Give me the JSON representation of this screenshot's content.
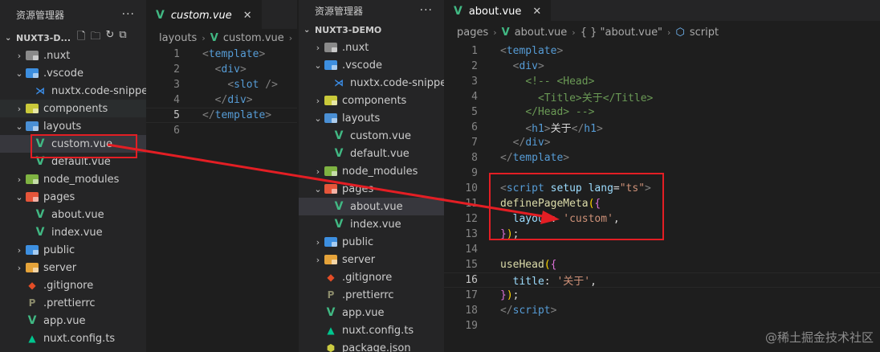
{
  "left": {
    "explorer": {
      "title": "资源管理器",
      "more": "···",
      "root": "NUXT3-D...",
      "items": [
        {
          "label": ".nuxt",
          "kind": "folder",
          "depth": 1,
          "twisty": "›",
          "color": "#8a8a8a"
        },
        {
          "label": ".vscode",
          "kind": "folder",
          "depth": 1,
          "twisty": "⌄",
          "color": "#3d8fe0"
        },
        {
          "label": "nuxtx.code-snippets",
          "kind": "vscode",
          "depth": 2,
          "twisty": ""
        },
        {
          "label": "components",
          "kind": "folder",
          "depth": 1,
          "twisty": "›",
          "color": "#c9c93a",
          "state": "highlight"
        },
        {
          "label": "layouts",
          "kind": "folder",
          "depth": 1,
          "twisty": "⌄",
          "color": "#4a8fd4"
        },
        {
          "label": "custom.vue",
          "kind": "vue",
          "depth": 2,
          "twisty": "",
          "state": "selected"
        },
        {
          "label": "default.vue",
          "kind": "vue",
          "depth": 2,
          "twisty": ""
        },
        {
          "label": "node_modules",
          "kind": "folder",
          "depth": 1,
          "twisty": "›",
          "color": "#7fb342"
        },
        {
          "label": "pages",
          "kind": "folder",
          "depth": 1,
          "twisty": "⌄",
          "color": "#e5553a"
        },
        {
          "label": "about.vue",
          "kind": "vue",
          "depth": 2,
          "twisty": ""
        },
        {
          "label": "index.vue",
          "kind": "vue",
          "depth": 2,
          "twisty": ""
        },
        {
          "label": "public",
          "kind": "folder",
          "depth": 1,
          "twisty": "›",
          "color": "#3d8fe0"
        },
        {
          "label": "server",
          "kind": "folder",
          "depth": 1,
          "twisty": "›",
          "color": "#e5a33a"
        },
        {
          "label": ".gitignore",
          "kind": "git",
          "depth": 1,
          "twisty": ""
        },
        {
          "label": ".prettierrc",
          "kind": "prettier",
          "depth": 1,
          "twisty": ""
        },
        {
          "label": "app.vue",
          "kind": "vue",
          "depth": 1,
          "twisty": ""
        },
        {
          "label": "nuxt.config.ts",
          "kind": "nuxt",
          "depth": 1,
          "twisty": ""
        },
        {
          "label": "",
          "kind": "json",
          "depth": 1,
          "twisty": ""
        }
      ]
    },
    "tab": {
      "label": "custom.vue",
      "close": "✕"
    },
    "breadcrumb": {
      "folder": "layouts",
      "file": "custom.vue"
    },
    "code": {
      "active_line": 5,
      "lines": [
        [
          {
            "c": "t-tag-gray",
            "t": "<"
          },
          {
            "c": "t-tag",
            "t": "template"
          },
          {
            "c": "t-tag-gray",
            "t": ">"
          }
        ],
        [
          {
            "c": "t-plain",
            "t": "  "
          },
          {
            "c": "t-tag-gray",
            "t": "<"
          },
          {
            "c": "t-tag",
            "t": "div"
          },
          {
            "c": "t-tag-gray",
            "t": ">"
          }
        ],
        [
          {
            "c": "t-plain",
            "t": "    "
          },
          {
            "c": "t-tag-gray",
            "t": "<"
          },
          {
            "c": "t-tag",
            "t": "slot"
          },
          {
            "c": "t-tag-gray",
            "t": " />"
          }
        ],
        [
          {
            "c": "t-plain",
            "t": "  "
          },
          {
            "c": "t-tag-gray",
            "t": "</"
          },
          {
            "c": "t-tag",
            "t": "div"
          },
          {
            "c": "t-tag-gray",
            "t": ">"
          }
        ],
        [
          {
            "c": "t-tag-gray",
            "t": "</"
          },
          {
            "c": "t-tag",
            "t": "template"
          },
          {
            "c": "t-tag-gray",
            "t": ">"
          }
        ],
        []
      ]
    }
  },
  "right": {
    "explorer": {
      "title": "资源管理器",
      "more": "···",
      "root": "NUXT3-DEMO",
      "items": [
        {
          "label": ".nuxt",
          "kind": "folder",
          "depth": 1,
          "twisty": "›",
          "color": "#8a8a8a"
        },
        {
          "label": ".vscode",
          "kind": "folder",
          "depth": 1,
          "twisty": "⌄",
          "color": "#3d8fe0"
        },
        {
          "label": "nuxtx.code-snippets",
          "kind": "vscode",
          "depth": 2,
          "twisty": ""
        },
        {
          "label": "components",
          "kind": "folder",
          "depth": 1,
          "twisty": "›",
          "color": "#c9c93a"
        },
        {
          "label": "layouts",
          "kind": "folder",
          "depth": 1,
          "twisty": "⌄",
          "color": "#4a8fd4"
        },
        {
          "label": "custom.vue",
          "kind": "vue",
          "depth": 2,
          "twisty": ""
        },
        {
          "label": "default.vue",
          "kind": "vue",
          "depth": 2,
          "twisty": ""
        },
        {
          "label": "node_modules",
          "kind": "folder",
          "depth": 1,
          "twisty": "›",
          "color": "#7fb342"
        },
        {
          "label": "pages",
          "kind": "folder",
          "depth": 1,
          "twisty": "⌄",
          "color": "#e5553a"
        },
        {
          "label": "about.vue",
          "kind": "vue",
          "depth": 2,
          "twisty": "",
          "state": "selected"
        },
        {
          "label": "index.vue",
          "kind": "vue",
          "depth": 2,
          "twisty": ""
        },
        {
          "label": "public",
          "kind": "folder",
          "depth": 1,
          "twisty": "›",
          "color": "#3d8fe0"
        },
        {
          "label": "server",
          "kind": "folder",
          "depth": 1,
          "twisty": "›",
          "color": "#e5a33a"
        },
        {
          "label": ".gitignore",
          "kind": "git",
          "depth": 1,
          "twisty": ""
        },
        {
          "label": ".prettierrc",
          "kind": "prettier",
          "depth": 1,
          "twisty": ""
        },
        {
          "label": "app.vue",
          "kind": "vue",
          "depth": 1,
          "twisty": ""
        },
        {
          "label": "nuxt.config.ts",
          "kind": "nuxt",
          "depth": 1,
          "twisty": ""
        },
        {
          "label": "package.json",
          "kind": "json",
          "depth": 1,
          "twisty": ""
        }
      ]
    },
    "tab": {
      "label": "about.vue",
      "close": "✕"
    },
    "breadcrumb": {
      "folder": "pages",
      "file": "about.vue",
      "object": "{ } \"about.vue\"",
      "section": "script"
    },
    "code": {
      "active_line": 16,
      "lines": [
        [
          {
            "c": "t-tag-gray",
            "t": "<"
          },
          {
            "c": "t-tag",
            "t": "template"
          },
          {
            "c": "t-tag-gray",
            "t": ">"
          }
        ],
        [
          {
            "c": "t-plain",
            "t": "  "
          },
          {
            "c": "t-tag-gray",
            "t": "<"
          },
          {
            "c": "t-tag",
            "t": "div"
          },
          {
            "c": "t-tag-gray",
            "t": ">"
          }
        ],
        [
          {
            "c": "t-plain",
            "t": "    "
          },
          {
            "c": "t-cmt",
            "t": "<!-- <Head>"
          }
        ],
        [
          {
            "c": "t-plain",
            "t": "      "
          },
          {
            "c": "t-cmt",
            "t": "<Title>关于</Title>"
          }
        ],
        [
          {
            "c": "t-plain",
            "t": "    "
          },
          {
            "c": "t-cmt",
            "t": "</Head> -->"
          }
        ],
        [
          {
            "c": "t-plain",
            "t": "    "
          },
          {
            "c": "t-tag-gray",
            "t": "<"
          },
          {
            "c": "t-tag",
            "t": "h1"
          },
          {
            "c": "t-tag-gray",
            "t": ">"
          },
          {
            "c": "t-plain",
            "t": "关于"
          },
          {
            "c": "t-tag-gray",
            "t": "</"
          },
          {
            "c": "t-tag",
            "t": "h1"
          },
          {
            "c": "t-tag-gray",
            "t": ">"
          }
        ],
        [
          {
            "c": "t-plain",
            "t": "  "
          },
          {
            "c": "t-tag-gray",
            "t": "</"
          },
          {
            "c": "t-tag",
            "t": "div"
          },
          {
            "c": "t-tag-gray",
            "t": ">"
          }
        ],
        [
          {
            "c": "t-tag-gray",
            "t": "</"
          },
          {
            "c": "t-tag",
            "t": "template"
          },
          {
            "c": "t-tag-gray",
            "t": ">"
          }
        ],
        [],
        [
          {
            "c": "t-tag-gray",
            "t": "<"
          },
          {
            "c": "t-tag",
            "t": "script"
          },
          {
            "c": "t-plain",
            "t": " "
          },
          {
            "c": "t-attr",
            "t": "setup"
          },
          {
            "c": "t-plain",
            "t": " "
          },
          {
            "c": "t-attr",
            "t": "lang"
          },
          {
            "c": "t-plain",
            "t": "="
          },
          {
            "c": "t-str",
            "t": "\"ts\""
          },
          {
            "c": "t-tag-gray",
            "t": ">"
          }
        ],
        [
          {
            "c": "t-fn",
            "t": "definePageMeta"
          },
          {
            "c": "t-brace",
            "t": "("
          },
          {
            "c": "t-paren",
            "t": "{"
          }
        ],
        [
          {
            "c": "t-plain",
            "t": "  "
          },
          {
            "c": "t-prop",
            "t": "layout"
          },
          {
            "c": "t-plain",
            "t": ": "
          },
          {
            "c": "t-str",
            "t": "'custom'"
          },
          {
            "c": "t-plain",
            "t": ","
          }
        ],
        [
          {
            "c": "t-paren",
            "t": "}"
          },
          {
            "c": "t-brace",
            "t": ")"
          },
          {
            "c": "t-plain",
            "t": ";"
          }
        ],
        [],
        [
          {
            "c": "t-fn",
            "t": "useHead"
          },
          {
            "c": "t-brace",
            "t": "("
          },
          {
            "c": "t-paren",
            "t": "{"
          }
        ],
        [
          {
            "c": "t-plain",
            "t": "  "
          },
          {
            "c": "t-prop",
            "t": "title"
          },
          {
            "c": "t-plain",
            "t": ": "
          },
          {
            "c": "t-str",
            "t": "'关于'"
          },
          {
            "c": "t-plain",
            "t": ","
          }
        ],
        [
          {
            "c": "t-paren",
            "t": "}"
          },
          {
            "c": "t-brace",
            "t": ")"
          },
          {
            "c": "t-plain",
            "t": ";"
          }
        ],
        [
          {
            "c": "t-tag-gray",
            "t": "</"
          },
          {
            "c": "t-tag",
            "t": "script"
          },
          {
            "c": "t-tag-gray",
            "t": ">"
          }
        ],
        []
      ]
    }
  },
  "watermark": "@稀土掘金技术社区",
  "colors": {
    "annotation": "#e31e24",
    "vue": "#41b883"
  }
}
